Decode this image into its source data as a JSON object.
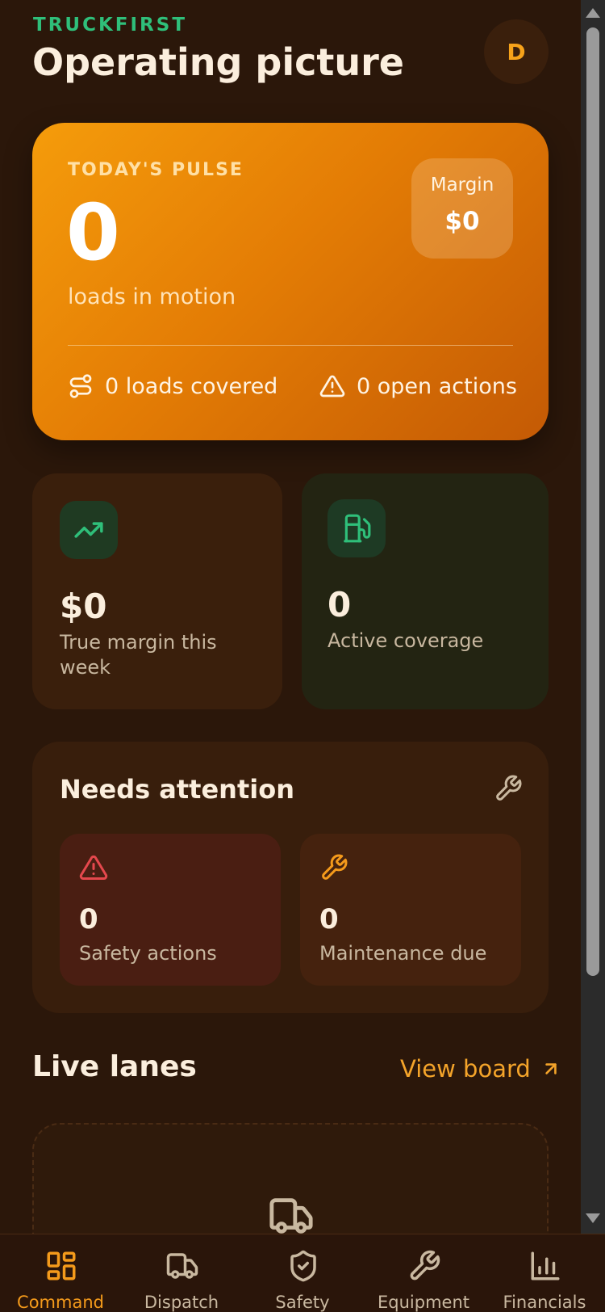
{
  "header": {
    "brand": "TRUCKFIRST",
    "title": "Operating picture",
    "avatar_initial": "D"
  },
  "pulse": {
    "label": "TODAY'S PULSE",
    "value": "0",
    "caption": "loads in motion",
    "margin_label": "Margin",
    "margin_value": "$0",
    "covered": "0 loads covered",
    "open_actions": "0 open actions"
  },
  "metrics": [
    {
      "value": "$0",
      "caption": "True margin this week",
      "icon": "trending-up-icon"
    },
    {
      "value": "0",
      "caption": "Active coverage",
      "icon": "fuel-icon"
    }
  ],
  "attention": {
    "title": "Needs attention",
    "tiles": [
      {
        "value": "0",
        "caption": "Safety actions",
        "icon": "warning-icon"
      },
      {
        "value": "0",
        "caption": "Maintenance due",
        "icon": "wrench-icon"
      }
    ]
  },
  "lanes": {
    "title": "Live lanes",
    "view_board": "View board"
  },
  "nav": [
    {
      "label": "Command",
      "icon": "grid-icon",
      "active": true
    },
    {
      "label": "Dispatch",
      "icon": "truck-icon",
      "active": false
    },
    {
      "label": "Safety",
      "icon": "shield-icon",
      "active": false
    },
    {
      "label": "Equipment",
      "icon": "wrench-icon",
      "active": false
    },
    {
      "label": "Financials",
      "icon": "bar-chart-icon",
      "active": false
    }
  ],
  "colors": {
    "background": "#2b170a",
    "accent": "#f49a1b",
    "brand_green": "#2fbf7a"
  }
}
